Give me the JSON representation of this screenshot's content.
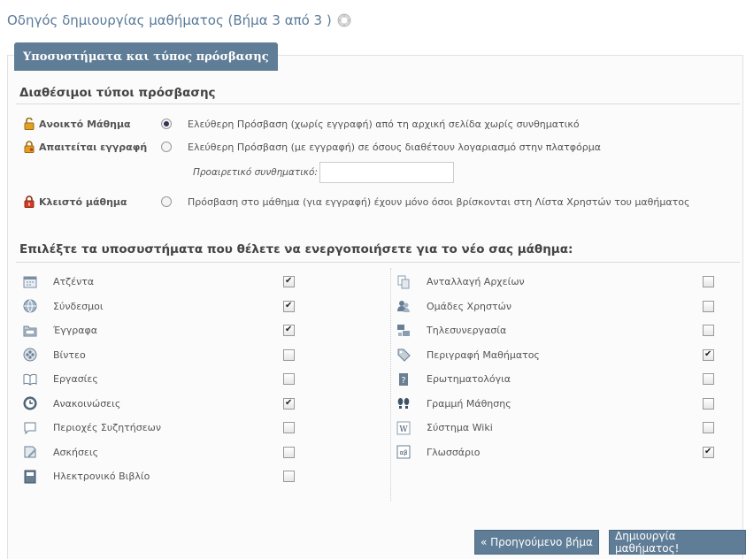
{
  "page": {
    "title": "Οδηγός δημιουργίας μαθήματος (Βήμα 3 από 3 )"
  },
  "panel": {
    "legend": "Υποσυστήματα και τύπος πρόσβασης"
  },
  "access": {
    "section_title": "Διαθέσιμοι τύποι πρόσβασης",
    "options": [
      {
        "label": "Ανοικτό Μάθημα",
        "description": "Ελεύθερη Πρόσβαση (χωρίς εγγραφή) από τη αρχική σελίδα χωρίς συνθηματικό",
        "selected": true,
        "lock_icon": "lock-open-icon",
        "lock_color": "#e2a020"
      },
      {
        "label": "Απαιτείται εγγραφή",
        "description": "Ελεύθερη Πρόσβαση (με εγγραφή) σε όσους διαθέτουν λογαριασμό στην πλατφόρμα",
        "selected": false,
        "lock_icon": "lock-key-icon",
        "lock_color": "#e2a020"
      },
      {
        "label": "Κλειστό μάθημα",
        "description": "Πρόσβαση στο μάθημα (για εγγραφή) έχουν μόνο όσοι βρίσκονται στη Λίστα Χρηστών του μαθήματος",
        "selected": false,
        "lock_icon": "lock-closed-icon",
        "lock_color": "#d83a2a"
      }
    ],
    "password_label": "Προαιρετικό συνθηματικό:",
    "password_value": ""
  },
  "modules": {
    "section_title": "Επιλέξτε τα υποσυστήματα που θέλετε να ενεργοποιήσετε για το νέο σας μάθημα:",
    "left": [
      {
        "label": "Ατζέντα",
        "checked": true,
        "icon": "agenda-icon"
      },
      {
        "label": "Σύνδεσμοι",
        "checked": true,
        "icon": "links-icon"
      },
      {
        "label": "Έγγραφα",
        "checked": true,
        "icon": "documents-icon"
      },
      {
        "label": "Βίντεο",
        "checked": false,
        "icon": "video-icon"
      },
      {
        "label": "Εργασίες",
        "checked": false,
        "icon": "assignments-icon"
      },
      {
        "label": "Ανακοινώσεις",
        "checked": true,
        "icon": "announcements-icon"
      },
      {
        "label": "Περιοχές Συζητήσεων",
        "checked": false,
        "icon": "forum-icon"
      },
      {
        "label": "Ασκήσεις",
        "checked": false,
        "icon": "exercises-icon"
      },
      {
        "label": "Ηλεκτρονικό Βιβλίο",
        "checked": false,
        "icon": "ebook-icon"
      }
    ],
    "right": [
      {
        "label": "Ανταλλαγή Αρχείων",
        "checked": false,
        "icon": "file-exchange-icon"
      },
      {
        "label": "Ομάδες Χρηστών",
        "checked": false,
        "icon": "user-groups-icon"
      },
      {
        "label": "Τηλεσυνεργασία",
        "checked": false,
        "icon": "teleconference-icon"
      },
      {
        "label": "Περιγραφή Μαθήματος",
        "checked": true,
        "icon": "course-description-icon"
      },
      {
        "label": "Ερωτηματολόγια",
        "checked": false,
        "icon": "questionnaire-icon"
      },
      {
        "label": "Γραμμή Μάθησης",
        "checked": false,
        "icon": "learning-path-icon"
      },
      {
        "label": "Σύστημα Wiki",
        "checked": false,
        "icon": "wiki-icon"
      },
      {
        "label": "Γλωσσάριο",
        "checked": true,
        "icon": "glossary-icon"
      }
    ]
  },
  "buttons": {
    "previous": "« Προηγούμενο βήμα",
    "create": "Δημιουργία μαθήματος!"
  }
}
